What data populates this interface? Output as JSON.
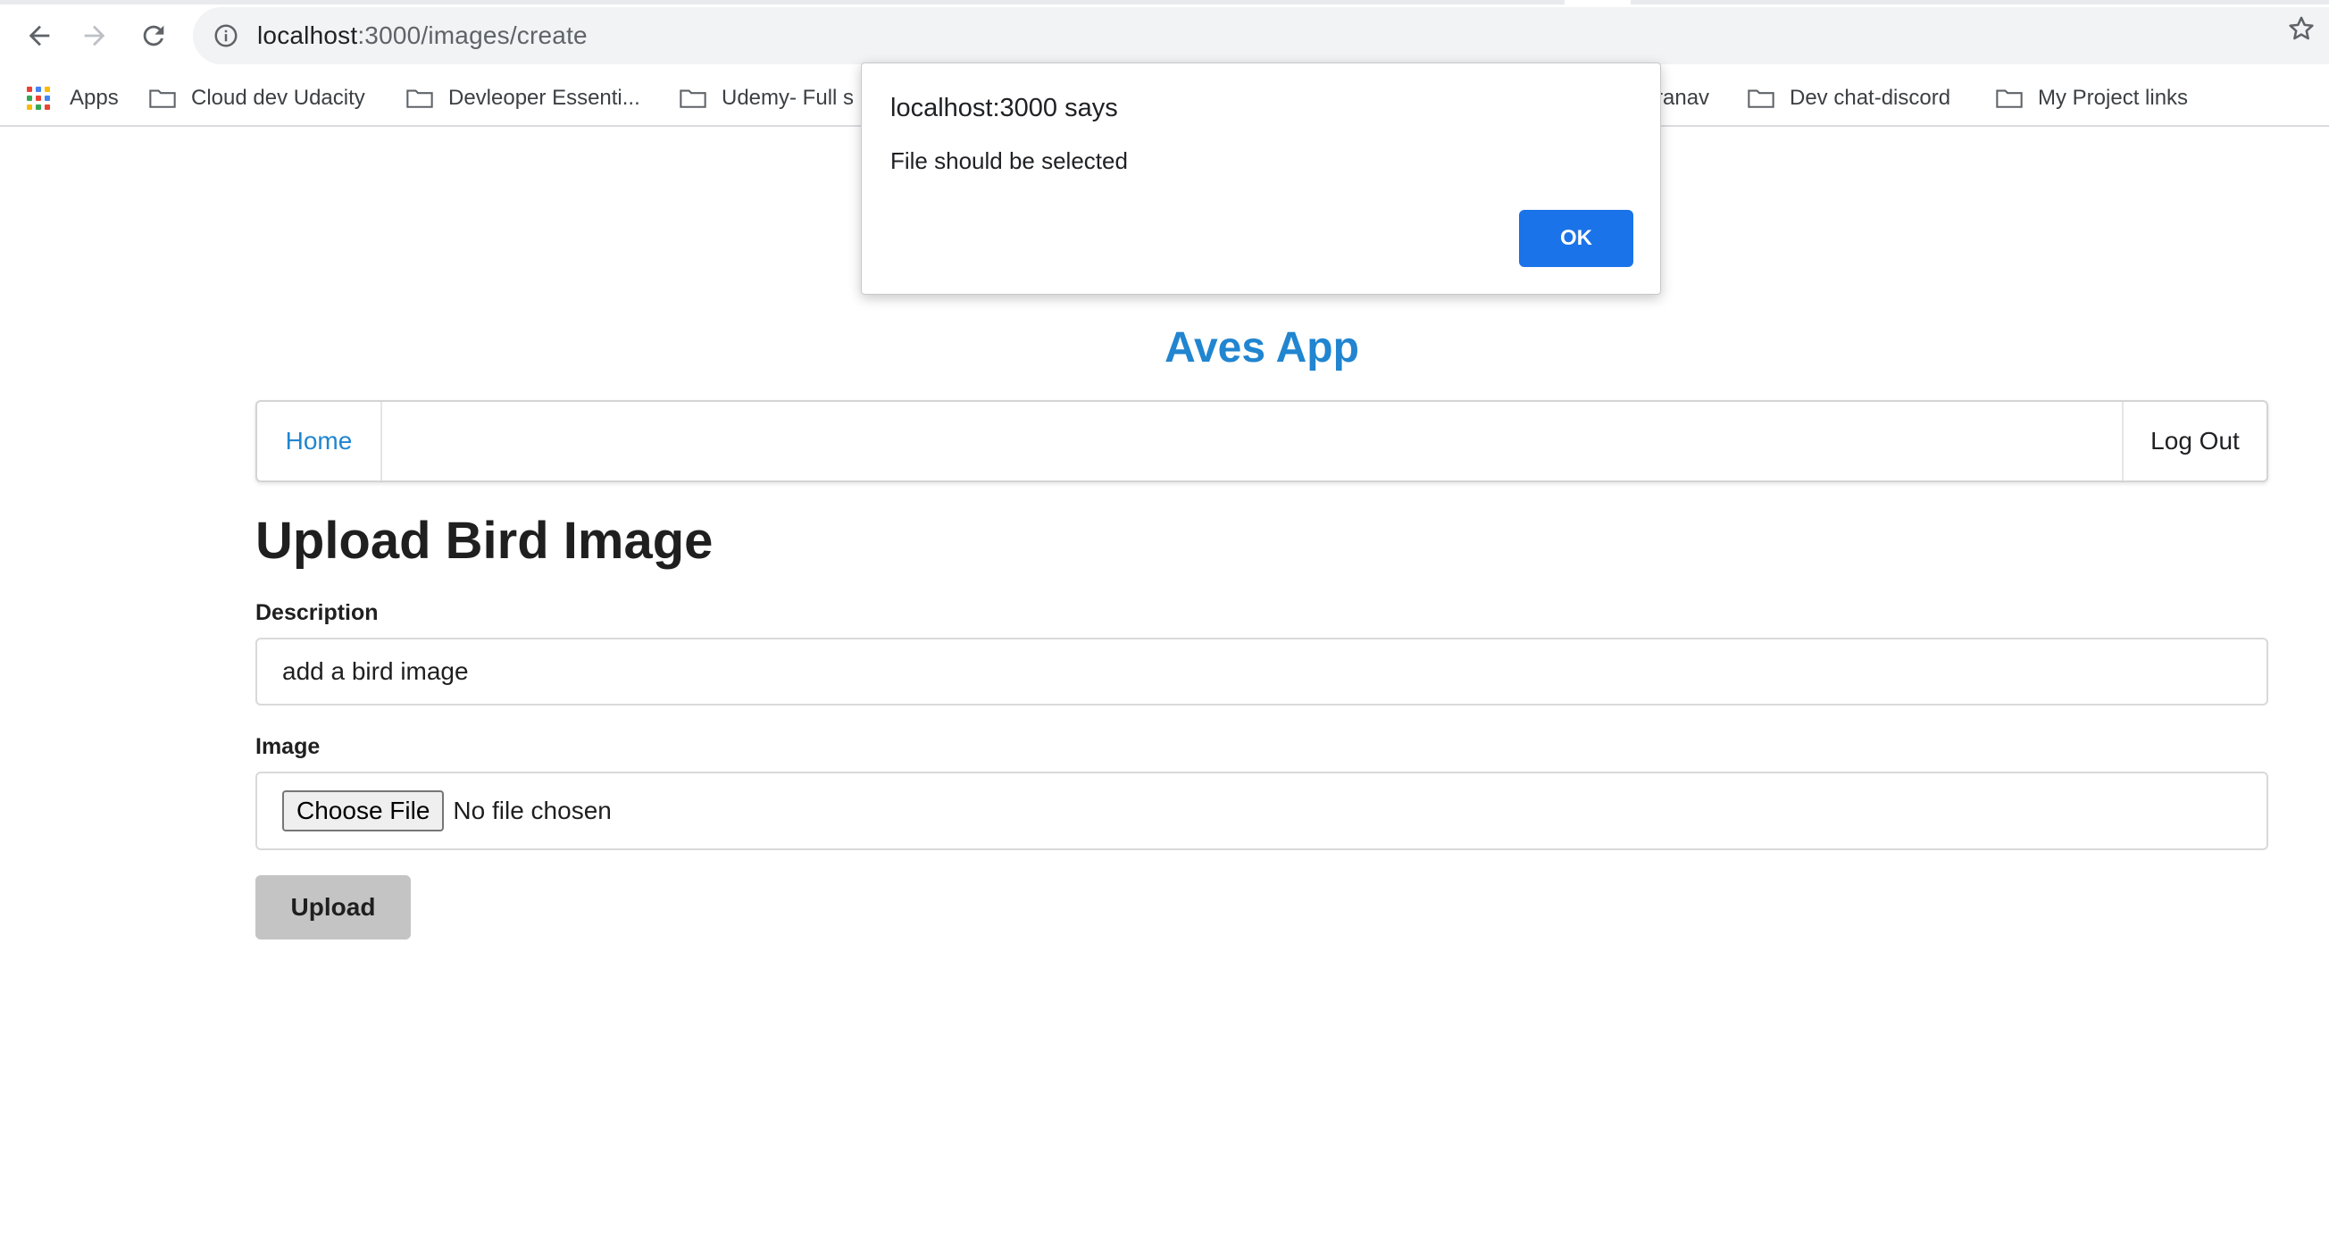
{
  "browser": {
    "url_host": "localhost",
    "url_rest": ":3000/images/create",
    "bookmarks": [
      {
        "label": "Apps",
        "icon": "apps-grid-icon"
      },
      {
        "label": "Cloud dev Udacity",
        "icon": "folder-icon"
      },
      {
        "label": "Devleoper Essenti...",
        "icon": "folder-icon"
      },
      {
        "label": "Udemy- Full s",
        "icon": "folder-icon"
      },
      {
        "label": "Pranav",
        "icon": "folder-icon"
      },
      {
        "label": "Dev chat-discord",
        "icon": "folder-icon"
      },
      {
        "label": "My Project links",
        "icon": "folder-icon"
      }
    ]
  },
  "dialog": {
    "title": "localhost:3000 says",
    "message": "File should be selected",
    "ok_label": "OK",
    "ok_color": "#1a73e8"
  },
  "app": {
    "brand": "Aves App",
    "brand_color": "#2185d0",
    "menu": {
      "home_label": "Home",
      "logout_label": "Log Out"
    },
    "page_title": "Upload Bird Image",
    "form": {
      "description_label": "Description",
      "description_value": "add a bird image",
      "image_label": "Image",
      "choose_file_label": "Choose File",
      "no_file_text": "No file chosen",
      "upload_label": "Upload"
    }
  }
}
